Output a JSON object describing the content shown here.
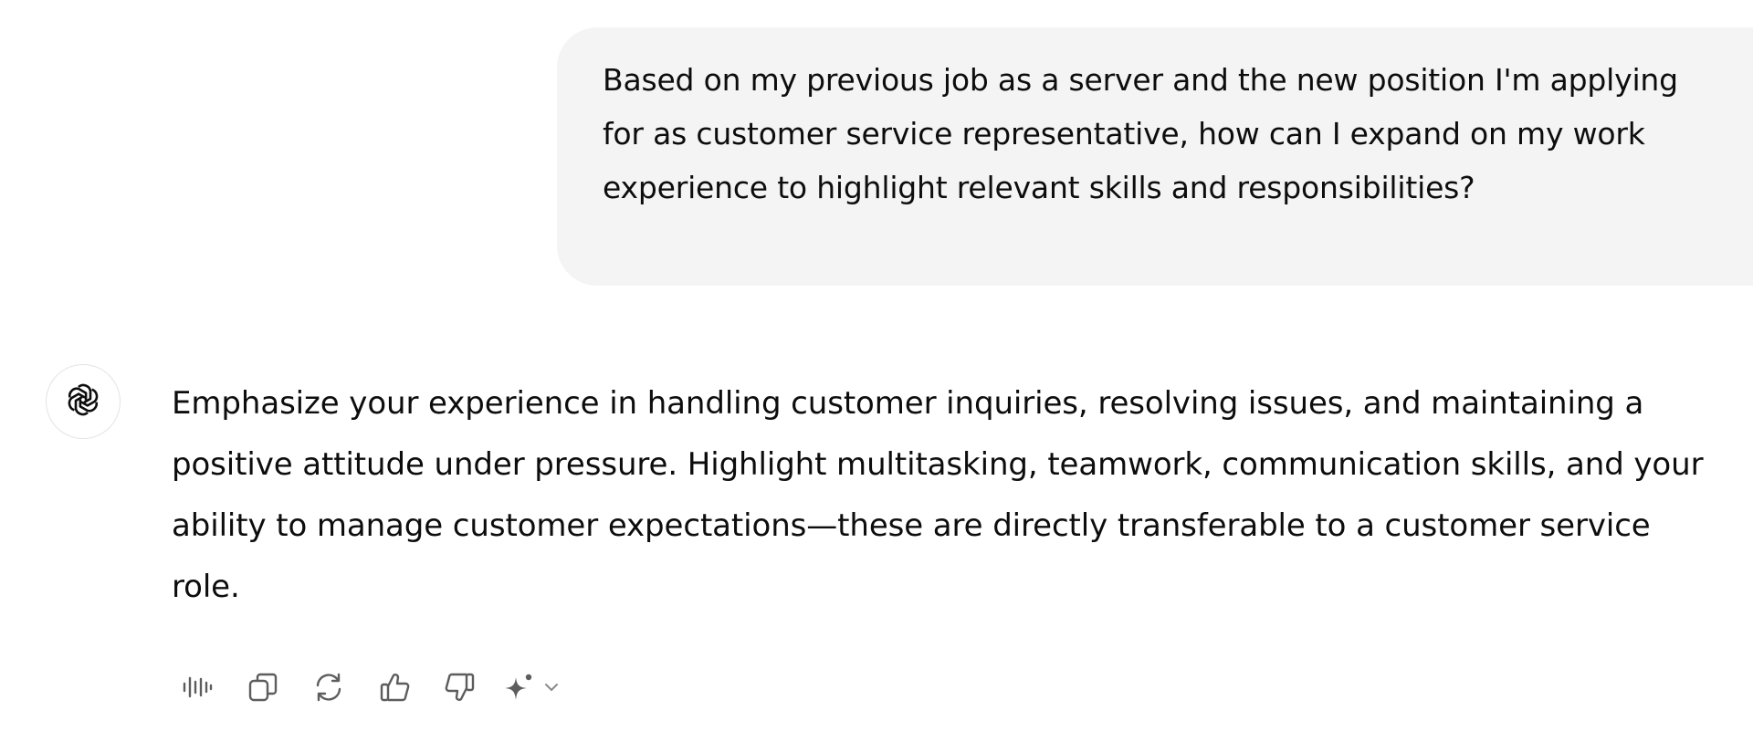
{
  "conversation": {
    "user_message": "Based on my previous job as a server and the new position I'm applying for as customer service representative, how can I expand on my work experience to highlight relevant skills and responsibilities?",
    "assistant_message": "Emphasize your experience in handling customer inquiries, resolving issues, and maintaining a positive attitude under pressure. Highlight multitasking, teamwork, communication skills, and your ability to manage customer expectations—these are directly transferable to a customer service role."
  },
  "assistant": {
    "avatar_icon": "openai-logo-icon"
  },
  "actions": [
    {
      "name": "read-aloud-button",
      "icon": "waveform-icon"
    },
    {
      "name": "copy-button",
      "icon": "copy-icon"
    },
    {
      "name": "regenerate-button",
      "icon": "refresh-icon"
    },
    {
      "name": "thumbs-up-button",
      "icon": "thumbs-up-icon"
    },
    {
      "name": "thumbs-down-button",
      "icon": "thumbs-down-icon"
    },
    {
      "name": "switch-model-button",
      "icon": "sparkle-icon"
    }
  ],
  "colors": {
    "user_bubble_bg": "#f4f4f4",
    "text": "#0d0d0d",
    "icon": "#5d5d5d"
  }
}
